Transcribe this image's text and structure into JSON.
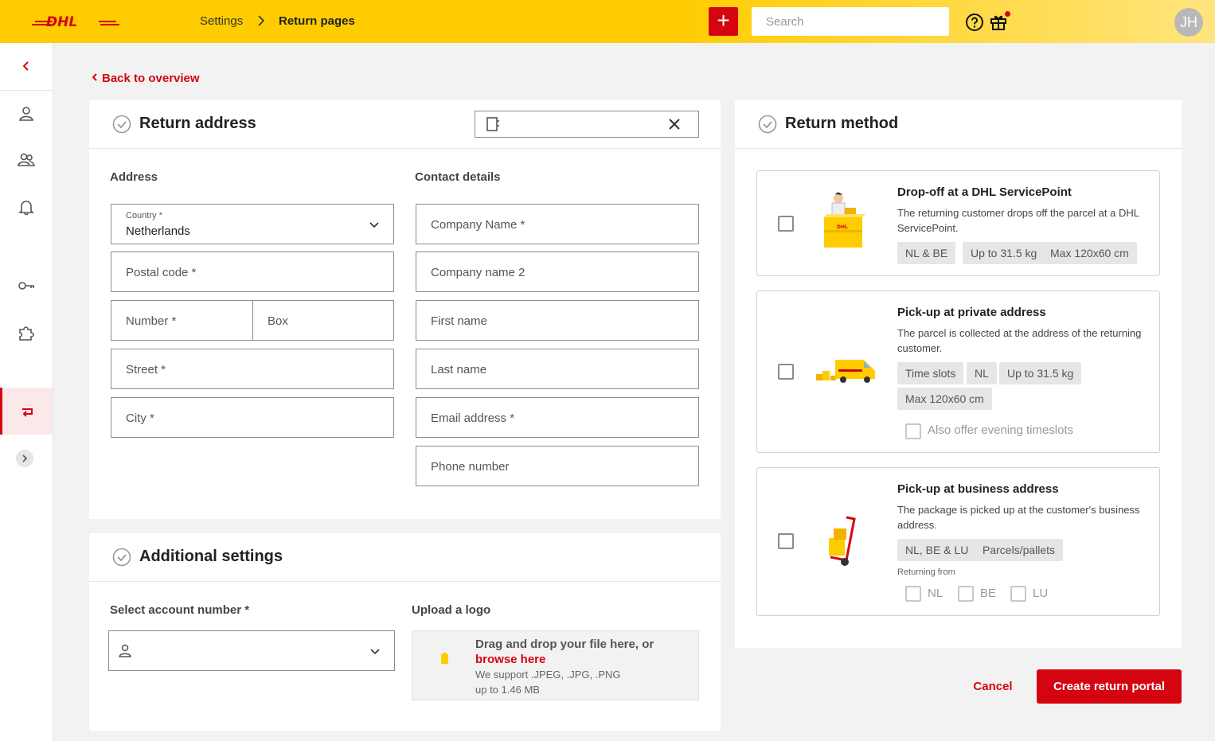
{
  "brand": {
    "logo_text": "DHL",
    "accent": "#d40511",
    "yellow": "#ffcc00"
  },
  "header": {
    "breadcrumb": [
      "Settings",
      "Return pages"
    ],
    "add_label": "+",
    "search_placeholder": "Search",
    "avatar_initials": "JH",
    "icons": [
      "help-icon",
      "gift-icon"
    ]
  },
  "sidebar": {
    "items": [
      "collapse-icon",
      "user-icon",
      "users-icon",
      "bell-icon",
      "key-icon",
      "puzzle-icon",
      "return-icon",
      "expand-icon"
    ],
    "active": "return-icon"
  },
  "back_link": "Back to overview",
  "return_address": {
    "title": "Return address",
    "address_label": "Address",
    "contact_label": "Contact details",
    "country_label": "Country *",
    "country_value": "Netherlands",
    "postal_code": "Postal code *",
    "number": "Number *",
    "box": "Box",
    "street": "Street *",
    "city": "City *",
    "company_name": "Company Name *",
    "company_name_2": "Company name 2",
    "first_name": "First name",
    "last_name": "Last name",
    "email": "Email address *",
    "phone": "Phone number"
  },
  "additional": {
    "title": "Additional settings",
    "account_label": "Select account number *",
    "upload_label": "Upload a logo",
    "upload_line1": "Drag and drop your file here, or",
    "upload_link": "browse here",
    "upload_formats": "We support .JPEG, .JPG, .PNG",
    "upload_size": "up to 1.46 MB"
  },
  "return_method": {
    "title": "Return method",
    "options": [
      {
        "title": "Drop-off at a DHL ServicePoint",
        "description": "The returning customer drops off the parcel at a DHL ServicePoint.",
        "chips": [
          "NL & BE",
          "Up to 31.5 kg",
          "Max 120x60 cm"
        ],
        "checked": false
      },
      {
        "title": "Pick-up at private address",
        "description": "The parcel is collected at the address of the returning customer.",
        "chips": [
          "Time slots",
          "NL",
          "Up to 31.5 kg",
          "Max 120x60 cm"
        ],
        "extra_checkbox": "Also offer evening timeslots",
        "checked": false
      },
      {
        "title": "Pick-up at business address",
        "description": "The package is picked up at the customer's business address.",
        "chips": [
          "NL, BE & LU",
          "Parcels/pallets"
        ],
        "returning_from_label": "Returning from",
        "countries": [
          "NL",
          "BE",
          "LU"
        ],
        "checked": false
      }
    ]
  },
  "actions": {
    "cancel": "Cancel",
    "create": "Create return portal"
  }
}
